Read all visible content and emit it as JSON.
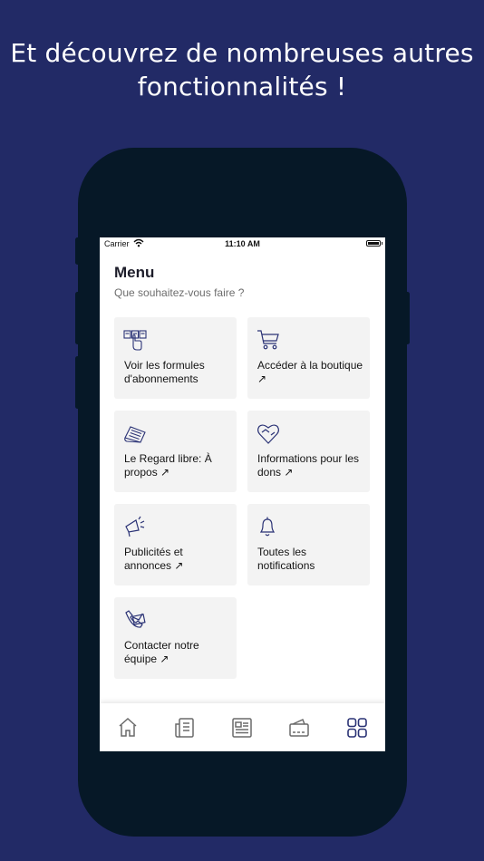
{
  "headline": {
    "line1": "Et découvrez de nombreuses autres",
    "line2": "fonctionnalités !"
  },
  "status_bar": {
    "carrier": "Carrier",
    "time": "11:10 AM"
  },
  "menu": {
    "title": "Menu",
    "subtitle": "Que souhaitez-vous faire ?",
    "items": [
      {
        "label": "Voir les formules d'abonnements",
        "icon": "subscription-cards-icon"
      },
      {
        "label": "Accéder à la boutique ↗",
        "icon": "shopping-cart-icon"
      },
      {
        "label": "Le Regard libre: À propos ↗",
        "icon": "newspaper-icon"
      },
      {
        "label": "Informations pour les dons ↗",
        "icon": "heart-hands-icon"
      },
      {
        "label": "Publicités et annonces ↗",
        "icon": "megaphone-icon"
      },
      {
        "label": "Toutes les notifications",
        "icon": "bell-icon"
      },
      {
        "label": "Contacter notre équipe ↗",
        "icon": "phone-mail-icon"
      }
    ]
  },
  "tab_bar": {
    "tabs": [
      {
        "icon": "home-icon",
        "active": false
      },
      {
        "icon": "articles-icon",
        "active": false
      },
      {
        "icon": "newspaper-edition-icon",
        "active": false
      },
      {
        "icon": "wallet-card-icon",
        "active": false
      },
      {
        "icon": "grid-menu-icon",
        "active": true
      }
    ]
  },
  "colors": {
    "background": "#222a66",
    "phone_frame": "#061827",
    "accent": "#2a3275",
    "card_bg": "#f3f3f3",
    "inactive_icon": "#6a6a6a"
  }
}
